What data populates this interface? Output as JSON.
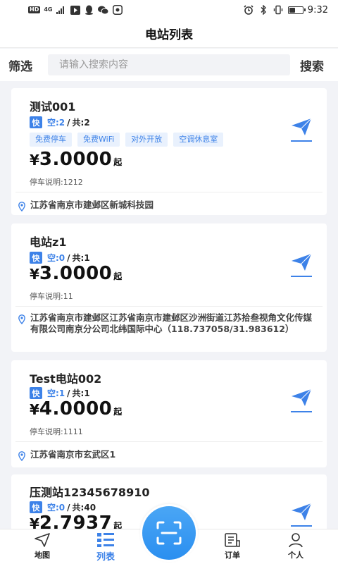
{
  "status_bar": {
    "hd": "HD",
    "network": "4G",
    "time": "9:32",
    "battery_level": 0.4
  },
  "title": "电站列表",
  "filter": {
    "filter_label": "筛选",
    "search_placeholder": "请输入搜索内容",
    "search_label": "搜索"
  },
  "stations": [
    {
      "name": "测试001",
      "fast_label": "快",
      "free_text": "空:2",
      "sep": "/",
      "total_text": "共:2",
      "tags": [
        "免费停车",
        "免费WiFi",
        "对外开放",
        "空调休息室"
      ],
      "price_symbol": "¥",
      "price": "3.0000",
      "price_unit": "起",
      "note": "停车说明:1212",
      "address": "江苏省南京市建邺区新城科技园"
    },
    {
      "name": "电站z1",
      "fast_label": "快",
      "free_text": "空:0",
      "sep": "/",
      "total_text": "共:1",
      "tags": [],
      "price_symbol": "¥",
      "price": "3.0000",
      "price_unit": "起",
      "note": "停车说明:11",
      "address": "江苏省南京市建邺区江苏省南京市建邺区沙洲街道江苏拾叁视角文化传媒有限公司南京分公司北纬国际中心（118.737058/31.983612）"
    },
    {
      "name": "Test电站002",
      "fast_label": "快",
      "free_text": "空:1",
      "sep": "/",
      "total_text": "共:1",
      "tags": [],
      "price_symbol": "¥",
      "price": "4.0000",
      "price_unit": "起",
      "note": "停车说明:1111",
      "address": "江苏省南京市玄武区1"
    },
    {
      "name": "压测站12345678910",
      "fast_label": "快",
      "free_text": "空:0",
      "sep": "/",
      "total_text": "共:40",
      "tags": [],
      "price_symbol": "¥",
      "price": "2.7937",
      "price_unit": "起",
      "note": "",
      "address": ""
    }
  ],
  "tabbar": {
    "map": "地图",
    "list": "列表",
    "orders": "订单",
    "profile": "个人"
  },
  "colors": {
    "accent": "#3d82e8",
    "tag_bg": "#e9f1fd",
    "page_bg": "#f2f3f7"
  }
}
